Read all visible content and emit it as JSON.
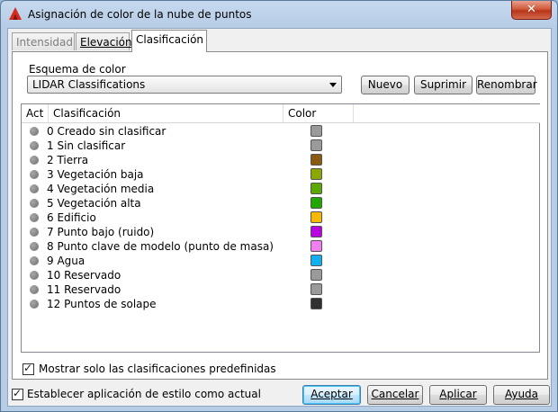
{
  "window": {
    "title": "Asignación de color de la nube de puntos",
    "close_label": "✕"
  },
  "tabs": [
    {
      "label": "Intensidad",
      "state": "disabled"
    },
    {
      "label": "Elevación",
      "state": "normal"
    },
    {
      "label": "Clasificación",
      "state": "active"
    }
  ],
  "scheme": {
    "group_label": "Esquema de color",
    "selected": "LIDAR Classifications",
    "new_label": "Nuevo",
    "delete_label": "Suprimir",
    "rename_label": "Renombrar"
  },
  "table": {
    "columns": [
      "Act",
      "Clasificación",
      "Color"
    ],
    "rows": [
      {
        "label": "0 Creado sin clasificar",
        "color": "#9a9a9a"
      },
      {
        "label": "1 Sin clasificar",
        "color": "#9a9a9a"
      },
      {
        "label": "2 Tierra",
        "color": "#8a5a10"
      },
      {
        "label": "3 Vegetación baja",
        "color": "#8aa800"
      },
      {
        "label": "4 Vegetación media",
        "color": "#5aa800"
      },
      {
        "label": "5 Vegetación alta",
        "color": "#20a800"
      },
      {
        "label": "6 Edificio",
        "color": "#f8b800"
      },
      {
        "label": "7 Punto bajo (ruido)",
        "color": "#b800e0"
      },
      {
        "label": "8 Punto clave de modelo (punto de masa)",
        "color": "#f080f0"
      },
      {
        "label": "9 Agua",
        "color": "#10b0f0"
      },
      {
        "label": "10 Reservado",
        "color": "#9a9a9a"
      },
      {
        "label": "11 Reservado",
        "color": "#9a9a9a"
      },
      {
        "label": "12 Puntos de solape",
        "color": "#303030"
      }
    ]
  },
  "options": {
    "show_predefined_label": "Mostrar solo las clasificaciones predefinidas",
    "show_predefined_checked": true,
    "set_current_label": "Establecer aplicación de estilo como actual",
    "set_current_checked": true
  },
  "footer": {
    "accept_label": "Aceptar",
    "cancel_label": "Cancelar",
    "apply_label": "Aplicar",
    "help_label": "Ayuda"
  }
}
